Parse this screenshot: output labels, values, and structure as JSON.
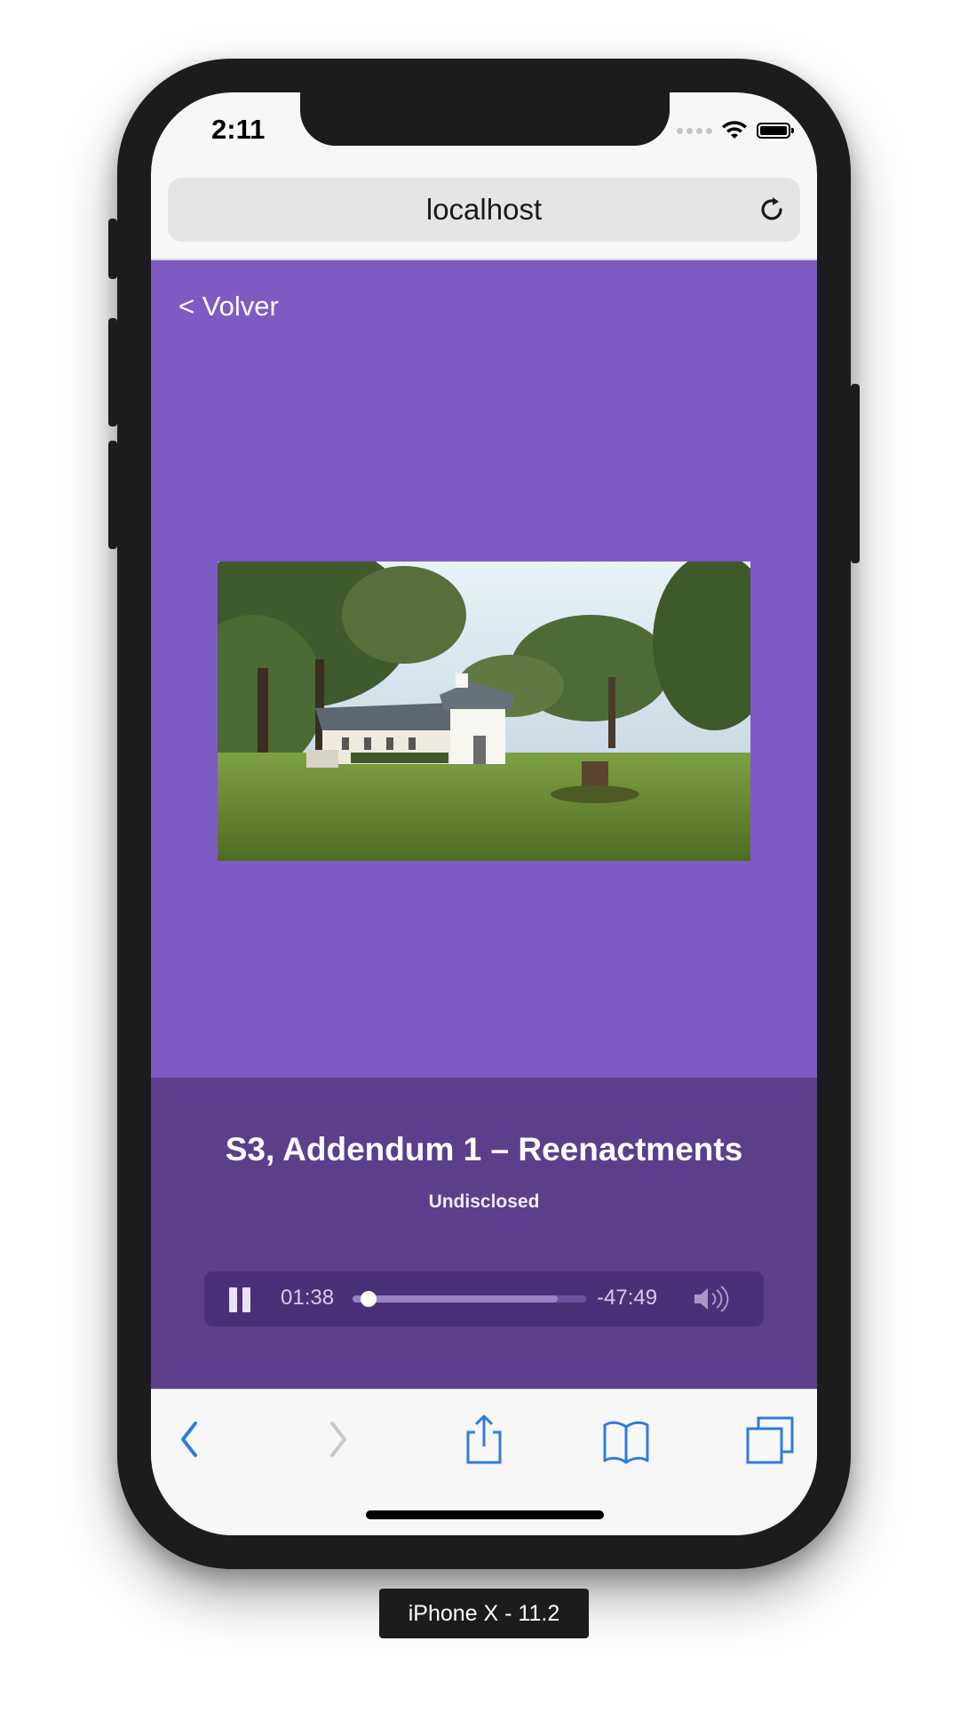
{
  "status_bar": {
    "time": "2:11"
  },
  "browser": {
    "url": "localhost"
  },
  "page": {
    "back_label": "< Volver",
    "episode": {
      "title": "S3, Addendum 1 – Reenactments",
      "podcast": "Undisclosed"
    },
    "player": {
      "state": "playing",
      "elapsed": "01:38",
      "remaining": "-47:49",
      "progress_fraction": 0.033,
      "buffered_fraction": 0.88
    }
  },
  "toolbar": {
    "icons": [
      "back-icon",
      "forward-icon",
      "share-icon",
      "bookmarks-icon",
      "tabs-icon"
    ]
  },
  "device_label": "iPhone X - 11.2",
  "colors": {
    "page_bg": "#7e5bc2",
    "player_section_bg": "#5b3f8b",
    "player_bar_bg": "#4a3177",
    "ios_tint": "#2f7bdc"
  }
}
